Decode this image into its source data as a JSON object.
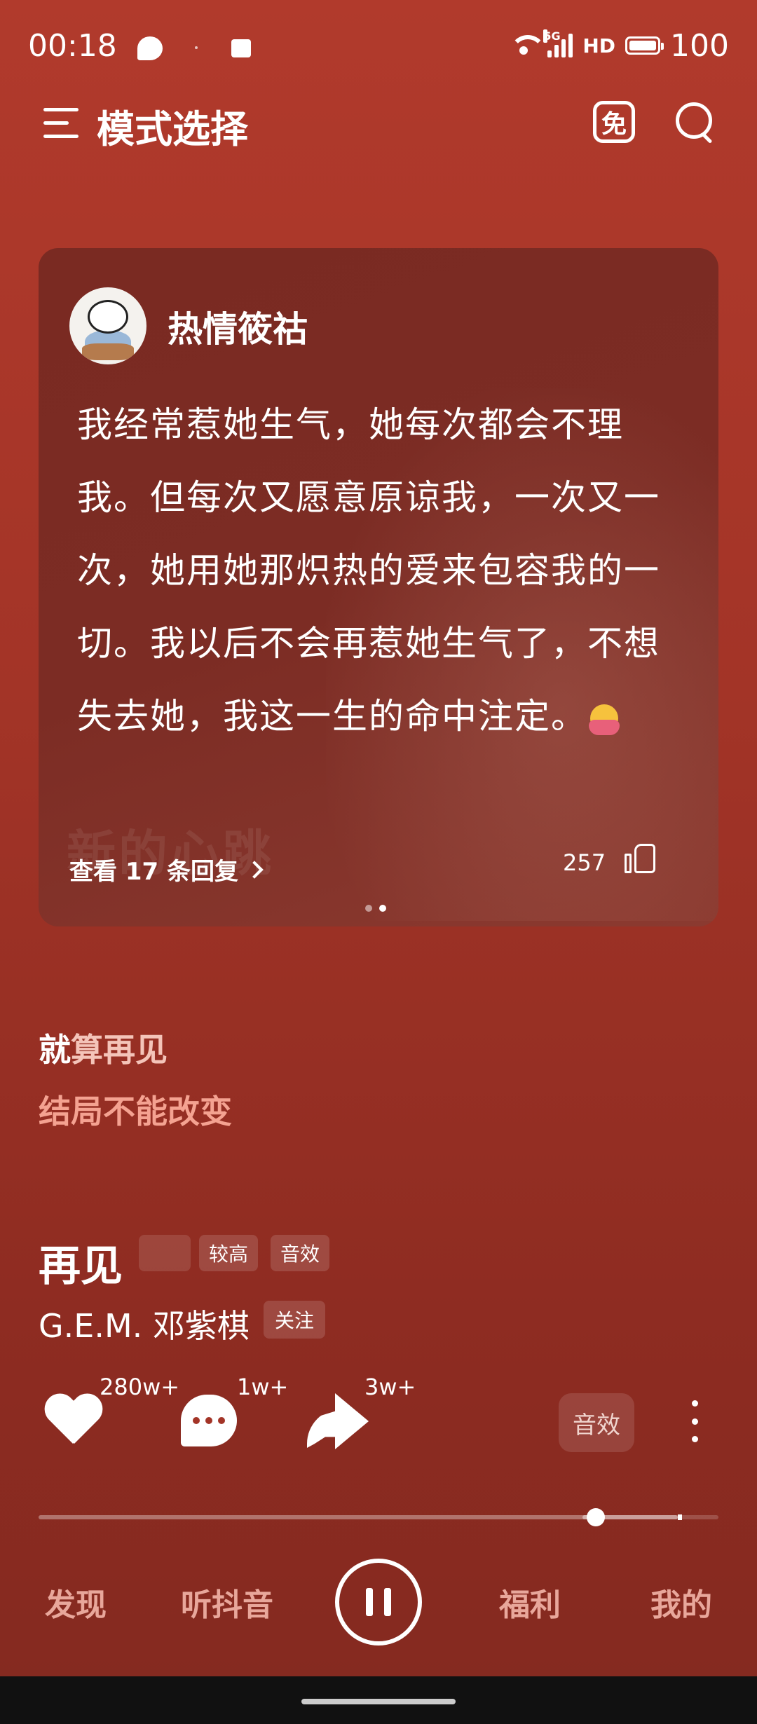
{
  "status_bar": {
    "time": "00:18",
    "network": "5G",
    "hd": "HD",
    "battery": "100"
  },
  "header": {
    "title": "模式选择",
    "free_icon_label": "免",
    "icons": [
      "menu-icon",
      "free-icon",
      "search-icon"
    ]
  },
  "comment": {
    "username": "热情筱祜",
    "text": "我经常惹她生气，她每次都会不理我。但每次又愿意原谅我，一次又一次，她用她那炽热的爱来包容我的一切。我以后不会再惹她生气了，不想失去她，我这一生的命中注定。",
    "emoji": "hugging-face-emoji",
    "watermark": "新的心跳",
    "replies_label": "查看 17 条回复",
    "like_count": "257",
    "page_dots": 2,
    "active_dot": 2
  },
  "lyrics": {
    "line1_played": "就",
    "line1_rest": "算再见",
    "line2": "结局不能改变"
  },
  "song": {
    "title": "再见",
    "tags": [
      "较高",
      "音效"
    ],
    "artist": "G.E.M. 邓紫棋",
    "follow_label": "关注"
  },
  "actions": {
    "like_count": "280w+",
    "comment_count": "1w+",
    "share_count": "3w+",
    "sound_label": "音效"
  },
  "progress": {
    "played_fraction": 0.82,
    "buffered_fraction": 0.94
  },
  "bottom_nav": {
    "items": [
      "发现",
      "听抖音",
      "福利",
      "我的"
    ],
    "playing": true
  },
  "colors": {
    "background_top": "#b13a2c",
    "background_bottom": "#842a20",
    "card": "#7c2c24",
    "lyric_accent": "#f4a291",
    "nav_text": "#e8a79b"
  }
}
